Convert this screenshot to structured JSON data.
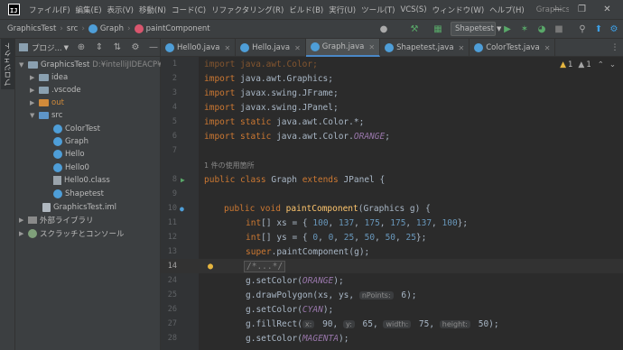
{
  "menu": {
    "items": [
      "ファイル(F)",
      "編集(E)",
      "表示(V)",
      "移動(N)",
      "コード(C)",
      "リファクタリング(R)",
      "ビルド(B)",
      "実行(U)",
      "ツール(T)",
      "VCS(S)",
      "ウィンドウ(W)",
      "ヘルプ(H)"
    ],
    "title": "GraphicsTe"
  },
  "nav": {
    "project": "GraphicsTest",
    "folder": "src",
    "class": "Graph",
    "method": "paintComponent",
    "run_config": "Shapetest"
  },
  "project_panel": {
    "header": "プロジ...",
    "stripe_label": "プロジェクト",
    "root": "GraphicsTest",
    "root_path": "D:¥intelliJIDEACP¥",
    "items": [
      {
        "label": "idea",
        "type": "folder"
      },
      {
        "label": ".vscode",
        "type": "folder"
      },
      {
        "label": "out",
        "type": "folder-orange"
      },
      {
        "label": "src",
        "type": "folder-blue"
      },
      {
        "label": "ColorTest",
        "type": "java"
      },
      {
        "label": "Graph",
        "type": "java"
      },
      {
        "label": "Hello",
        "type": "java"
      },
      {
        "label": "Hello0",
        "type": "java"
      },
      {
        "label": "Hello0.class",
        "type": "class"
      },
      {
        "label": "Shapetest",
        "type": "java"
      },
      {
        "label": "GraphicsTest.iml",
        "type": "iml"
      },
      {
        "label": "外部ライブラリ",
        "type": "lib"
      },
      {
        "label": "スクラッチとコンソール",
        "type": "scratch"
      }
    ]
  },
  "tabs": [
    "Hello0.java",
    "Hello.java",
    "Graph.java",
    "Shapetest.java",
    "ColorTest.java"
  ],
  "active_tab": "Graph.java",
  "editor": {
    "warnings_a": "1",
    "warnings_b": "1",
    "usage_text": "1 件の使用箇所",
    "line_numbers": [
      "1",
      "2",
      "3",
      "4",
      "5",
      "6",
      "7",
      "8",
      "9",
      "10",
      "11",
      "12",
      "13",
      "14",
      "24",
      "25",
      "26",
      "27",
      "28"
    ],
    "lines": {
      "l1": [
        "import java.awt.Color;"
      ],
      "l2": [
        "import",
        " java.awt.Graphics;"
      ],
      "l3": [
        "import",
        " javax.swing.JFrame;"
      ],
      "l4": [
        "import",
        " javax.swing.JPanel;"
      ],
      "l5": [
        "import static",
        " java.awt.Color.*;"
      ],
      "l6": [
        "import static",
        " java.awt.Color.",
        "ORANGE",
        ";"
      ],
      "l8": [
        "public class",
        " Graph ",
        "extends",
        " JPanel {"
      ],
      "l10": [
        "public void",
        " ",
        "paintComponent",
        "(Graphics g) {"
      ],
      "l11": [
        "int",
        "[] xs = { ",
        "100",
        ", ",
        "137",
        ", ",
        "175",
        ", ",
        "175",
        ", ",
        "137",
        ", ",
        "100",
        "};"
      ],
      "l12": [
        "int",
        "[] ys = { ",
        "0",
        ", ",
        "0",
        ", ",
        "25",
        ", ",
        "50",
        ", ",
        "50",
        ", ",
        "25",
        "};"
      ],
      "l13": [
        "super",
        ".paintComponent(g);"
      ],
      "l14": [
        "/*...*/"
      ],
      "l24": [
        "g.setColor(",
        "ORANGE",
        ");"
      ],
      "l25": [
        "g.drawPolygon(xs, ys, ",
        "nPoints:",
        " 6);"
      ],
      "l26": [
        "g.setColor(",
        "CYAN",
        ");"
      ],
      "l27": [
        "g.fillRect(",
        "x:",
        " 90, ",
        "y:",
        " 65, ",
        "width:",
        " 75, ",
        "height:",
        " 50);"
      ],
      "l28": [
        "g.setColor(",
        "MAGENTA",
        ");"
      ]
    }
  },
  "colors": {
    "keyword": "#cc7832",
    "number": "#6897bb",
    "constant": "#9876aa",
    "method": "#ffc66d",
    "text": "#a9b7c6",
    "selection": "#0d293e"
  }
}
